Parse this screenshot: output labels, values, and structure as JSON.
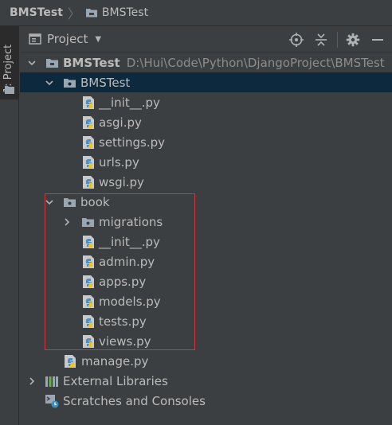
{
  "navbar": {
    "project": "BMSTest",
    "module": "BMSTest"
  },
  "strip": {
    "tab_label": "1: Project"
  },
  "header": {
    "view_label": "Project",
    "icons": [
      "locate-icon",
      "collapse-all-icon",
      "gear-icon",
      "minimize-icon"
    ]
  },
  "tree": {
    "root_name": "BMSTest",
    "root_path": "D:\\Hui\\Code\\Python\\DjangoProject\\BMSTest",
    "pkg_bmstest": "BMSTest",
    "bmstest_files": [
      "__init__.py",
      "asgi.py",
      "settings.py",
      "urls.py",
      "wsgi.py"
    ],
    "pkg_book": "book",
    "migrations": "migrations",
    "book_files": [
      "__init__.py",
      "admin.py",
      "apps.py",
      "models.py",
      "tests.py",
      "views.py"
    ],
    "manage": "manage.py",
    "external_libraries": "External Libraries",
    "scratches": "Scratches and Consoles"
  },
  "colors": {
    "background": "#3c3f41",
    "selection": "#0d293e",
    "text": "#bbbbbb",
    "path_text": "#8c8c8c",
    "highlight_border": "#d2383b",
    "python_blue": "#4a90c8",
    "python_yellow": "#f0c419"
  }
}
